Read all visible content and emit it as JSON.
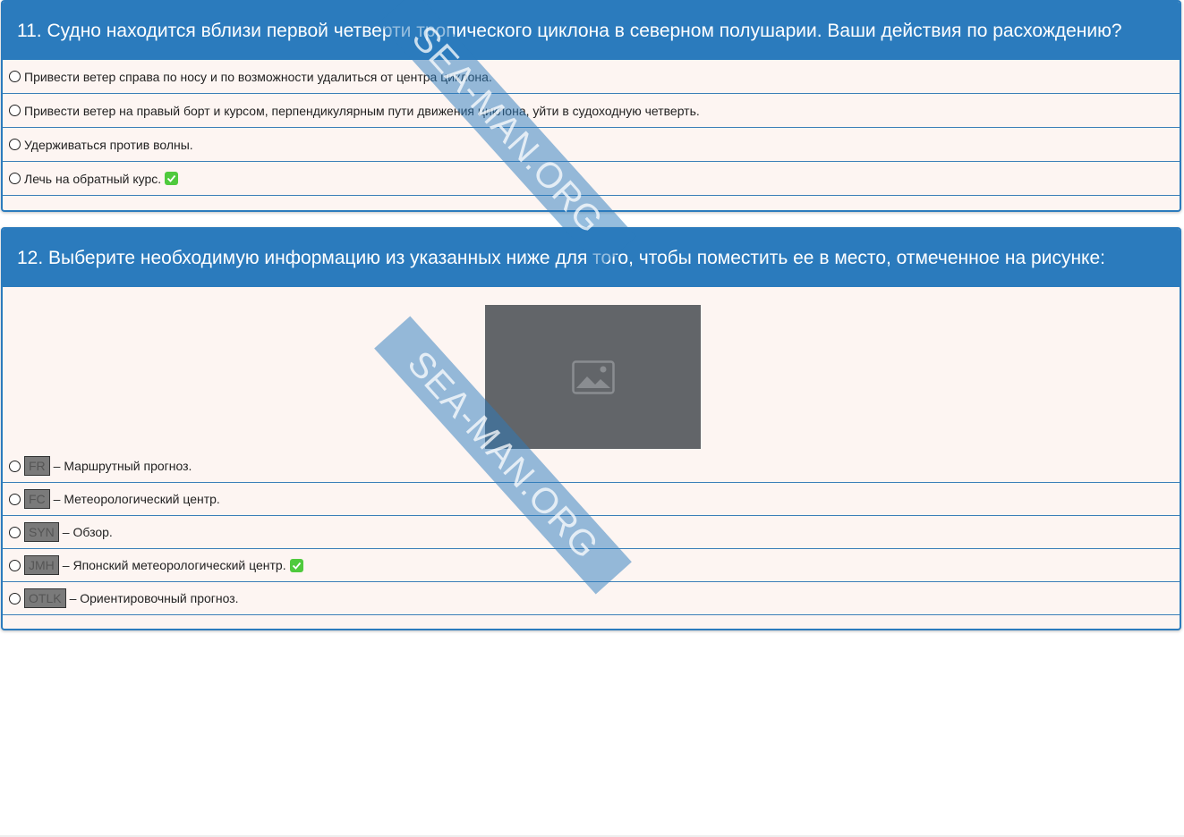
{
  "questions": [
    {
      "title": "11. Судно находится вблизи первой четверти тропического циклона в северном полушарии. Ваши действия по расхождению?",
      "options": [
        {
          "text": "Привести ветер справа по носу и по возможности удалиться от центра циклона."
        },
        {
          "text": "Привести ветер на правый борт и курсом, перпендикулярным пути движения циклона, уйти в судоходную четверть."
        },
        {
          "text": "Удерживаться против волны."
        },
        {
          "text": "Лечь на обратный курс.",
          "correct": true
        }
      ]
    },
    {
      "title": "12. Выберите необходимую информацию из указанных ниже для того, чтобы поместить ее в место, отмеченное на рисунке:",
      "image_icon": "image-placeholder-icon",
      "options": [
        {
          "code": "FR",
          "text": "– Маршрутный прогноз."
        },
        {
          "code": "FC",
          "text": "– Метеорологический центр."
        },
        {
          "code": "SYN",
          "text": "– Обзор."
        },
        {
          "code": "JMH",
          "text": "– Японский метеорологический центр.",
          "correct": true
        },
        {
          "code": "OTLK",
          "text": "– Ориентировочный прогноз."
        }
      ]
    }
  ],
  "watermark": "SEA-MAN.ORG",
  "colors": {
    "header": "#2b7bbd",
    "card_bg": "#fdf5f2",
    "correct": "#4fca3d",
    "code_bg": "#7a7a7a"
  }
}
